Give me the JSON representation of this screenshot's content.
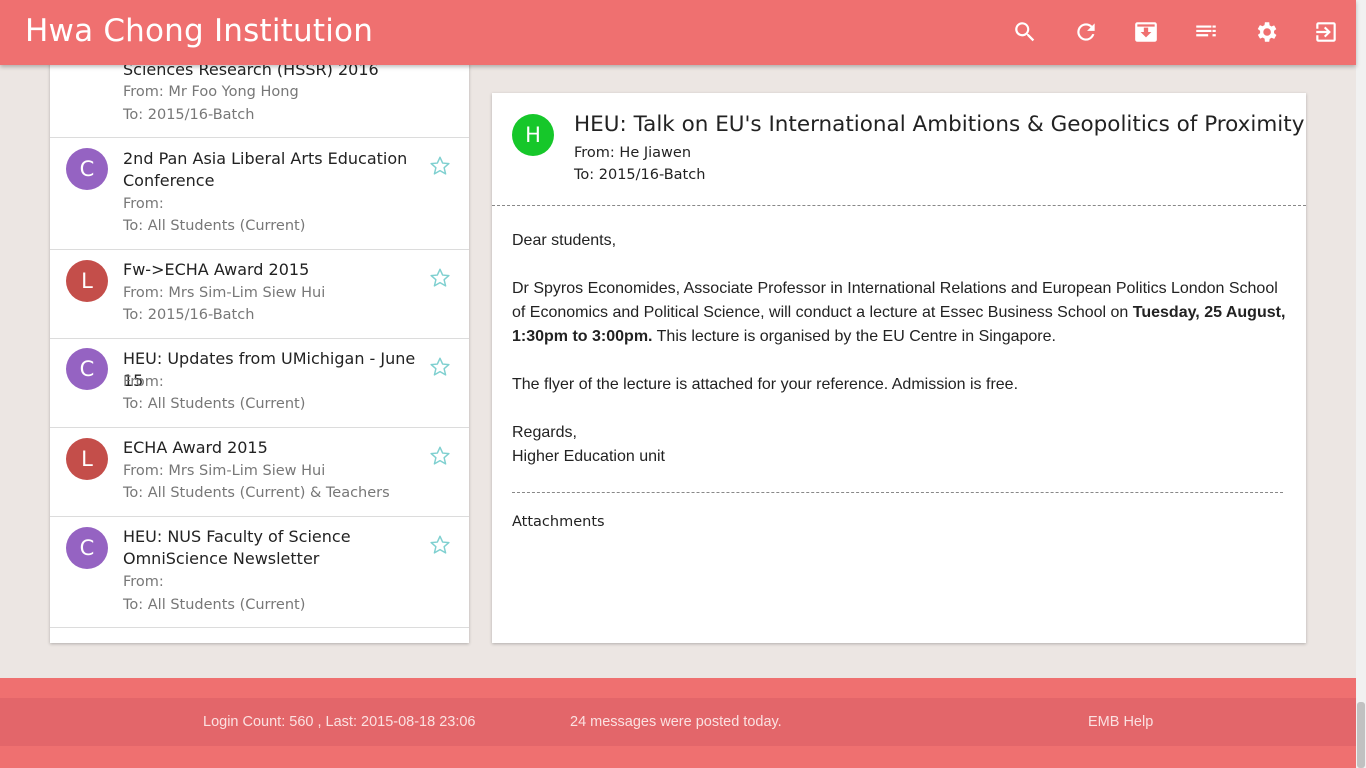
{
  "header": {
    "title": "Hwa Chong Institution",
    "icons": [
      "search-icon",
      "refresh-icon",
      "archive-icon",
      "list-icon",
      "settings-icon",
      "logout-icon"
    ]
  },
  "mail_list": [
    {
      "avatar_letter": "",
      "avatar_color": "#3b8ef0",
      "subject": "Sciences Research (HSSR) 2016",
      "from": "From: Mr Foo Yong Hong",
      "to": "To: 2015/16-Batch",
      "starred": false
    },
    {
      "avatar_letter": "C",
      "avatar_color": "#9563c2",
      "subject": "2nd Pan Asia Liberal Arts Education Conference",
      "from": "From:",
      "to": "To: All Students (Current)",
      "starred": false
    },
    {
      "avatar_letter": "L",
      "avatar_color": "#c44e4a",
      "subject": "Fw->ECHA Award 2015",
      "from": "From: Mrs Sim-Lim Siew Hui",
      "to": "To: 2015/16-Batch",
      "starred": false
    },
    {
      "avatar_letter": "C",
      "avatar_color": "#9563c2",
      "subject": "HEU: Updates from UMichigan - June 15",
      "from": "From:",
      "to": "To: All Students (Current)",
      "starred": false
    },
    {
      "avatar_letter": "L",
      "avatar_color": "#c44e4a",
      "subject": "ECHA Award 2015",
      "from": "From: Mrs Sim-Lim Siew Hui",
      "to": "To: All Students (Current) & Teachers",
      "starred": false
    },
    {
      "avatar_letter": "C",
      "avatar_color": "#9563c2",
      "subject": "HEU: NUS Faculty of Science OmniScience Newsletter",
      "from": "From:",
      "to": "To: All Students (Current)",
      "starred": false
    }
  ],
  "message": {
    "avatar_letter": "H",
    "avatar_color": "#16c72a",
    "subject": "HEU: Talk on EU's International Ambitions & Geopolitics of Proximity",
    "from": "From: He Jiawen",
    "to": "To: 2015/16-Batch",
    "greeting": "Dear students,",
    "para1_start": "Dr Spyros Economides, Associate Professor in International Relations and European Politics London School of Economics and Political Science, will conduct a lecture at Essec Business School on ",
    "para1_bold": "Tuesday, 25 August, 1:30pm to 3:00pm.",
    "para1_end": " This lecture is organised by the EU Centre in Singapore.",
    "para2": "The flyer of the lecture is attached for your reference. Admission is free.",
    "closing": "Regards,",
    "signature": "Higher Education unit",
    "attachments_label": "Attachments"
  },
  "footer": {
    "login_info": "Login Count: 560 , Last: 2015-08-18 23:06",
    "posted_today": "24 messages were posted today.",
    "help_link": "EMB Help"
  },
  "colors": {
    "header_bg": "#ef7070",
    "star_color": "#7fd0d0",
    "page_bg": "#ece6e3"
  }
}
